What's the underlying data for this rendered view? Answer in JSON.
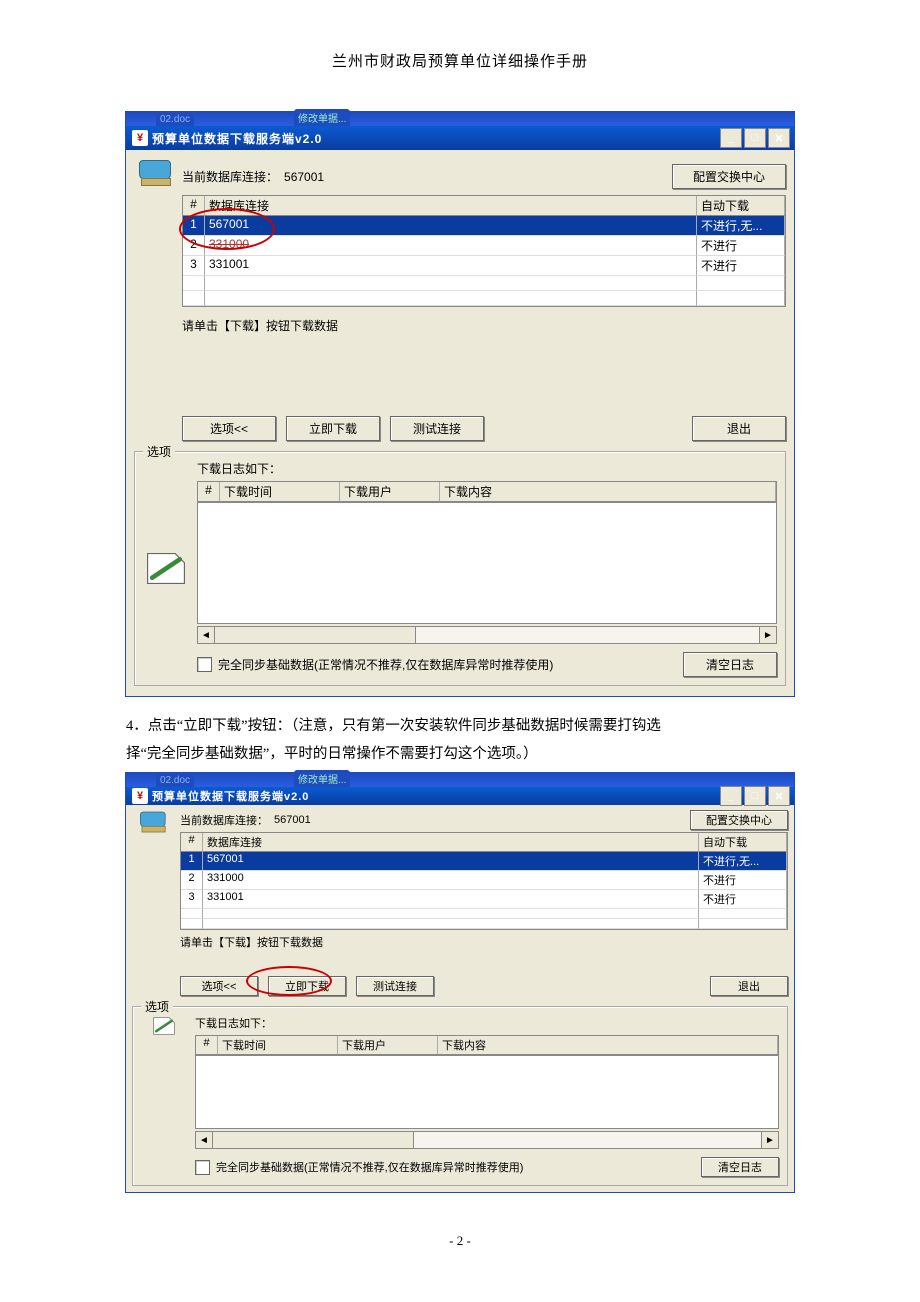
{
  "doc": {
    "header": "兰州市财政局预算单位详细操作手册",
    "page_number": "- 2 -"
  },
  "caption": {
    "line1": "4．点击“立即下载”按钮：（注意，只有第一次安装软件同步基础数据时候需要打钩选",
    "line2": "择“完全同步基础数据”，平时的日常操作不需要打勾这个选项。）"
  },
  "shot1": {
    "tab_left": "02.doc",
    "tab_right": "修改单据...",
    "title": "预算单位数据下载服务端v2.0",
    "conn_label": "当前数据库连接：",
    "conn_value": "567001",
    "top_grid": {
      "col_idx": "#",
      "col_db": "数据库连接",
      "col_auto": "自动下载",
      "rows": [
        {
          "n": "1",
          "db": "567001",
          "auto": "不进行,无..."
        },
        {
          "n": "2",
          "db": "331000",
          "auto": "不进行"
        },
        {
          "n": "3",
          "db": "331001",
          "auto": "不进行"
        }
      ]
    },
    "btn_config": "配置交换中心",
    "hint": "请单击【下载】按钮下载数据",
    "btn_options": "选项<<",
    "btn_download": "立即下载",
    "btn_test": "测试连接",
    "btn_exit": "退出",
    "group_label": "选项",
    "log_title": "下载日志如下：",
    "log_grid": {
      "col_idx": "#",
      "col_time": "下载时间",
      "col_user": "下载用户",
      "col_content": "下载内容"
    },
    "chk_label": "完全同步基础数据(正常情况不推荐,仅在数据库异常时推荐使用)",
    "btn_clear": "清空日志"
  },
  "shot2": {
    "tab_left": "02.doc",
    "tab_right": "修改单据...",
    "title": "预算单位数据下载服务端v2.0",
    "conn_label": "当前数据库连接：",
    "conn_value": "567001",
    "top_grid": {
      "col_idx": "#",
      "col_db": "数据库连接",
      "col_auto": "自动下载",
      "rows": [
        {
          "n": "1",
          "db": "567001",
          "auto": "不进行,无..."
        },
        {
          "n": "2",
          "db": "331000",
          "auto": "不进行"
        },
        {
          "n": "3",
          "db": "331001",
          "auto": "不进行"
        }
      ]
    },
    "btn_config": "配置交换中心",
    "hint": "请单击【下载】按钮下载数据",
    "btn_options": "选项<<",
    "btn_download": "立即下载",
    "btn_test": "测试连接",
    "btn_exit": "退出",
    "group_label": "选项",
    "log_title": "下载日志如下：",
    "log_grid": {
      "col_idx": "#",
      "col_time": "下载时间",
      "col_user": "下载用户",
      "col_content": "下载内容"
    },
    "chk_label": "完全同步基础数据(正常情况不推荐,仅在数据库异常时推荐使用)",
    "btn_clear": "清空日志"
  }
}
